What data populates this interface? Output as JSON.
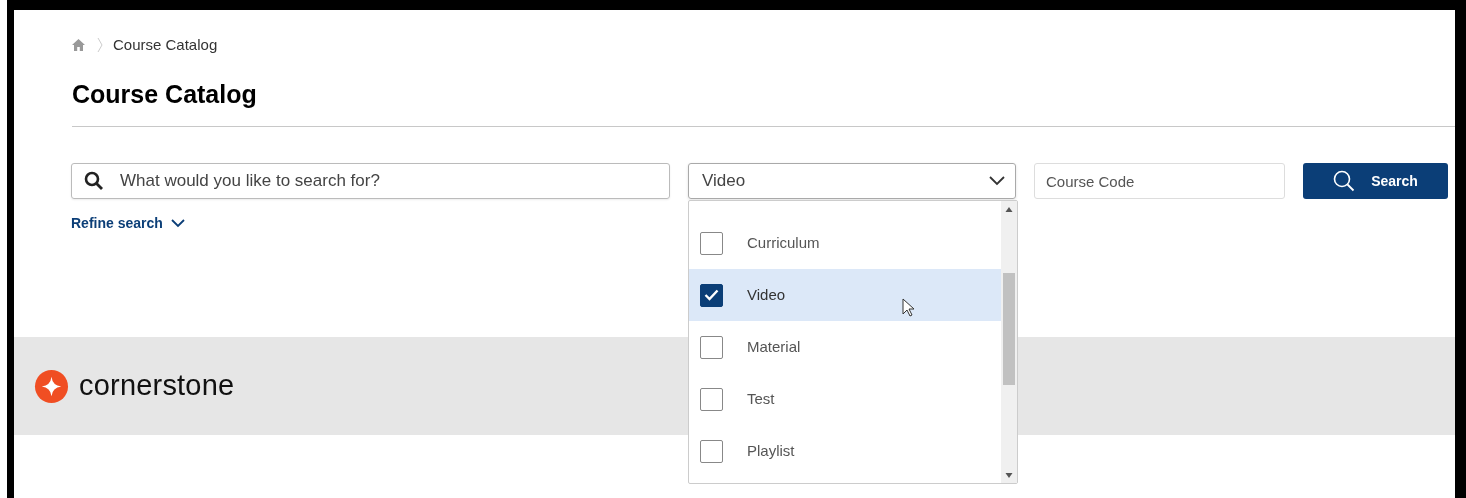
{
  "breadcrumb": {
    "items": [
      "Course Catalog"
    ]
  },
  "title": "Course Catalog",
  "search": {
    "placeholder": "What would you like to search for?"
  },
  "type_select": {
    "value": "Video",
    "expanded": true,
    "options": [
      {
        "label": "Curriculum",
        "checked": false,
        "selected": false
      },
      {
        "label": "Video",
        "checked": true,
        "selected": true
      },
      {
        "label": "Material",
        "checked": false,
        "selected": false
      },
      {
        "label": "Test",
        "checked": false,
        "selected": false
      },
      {
        "label": "Playlist",
        "checked": false,
        "selected": false
      }
    ]
  },
  "course_code": {
    "placeholder": "Course Code"
  },
  "search_button": {
    "label": "Search"
  },
  "refine_search": {
    "label": "Refine search",
    "expanded": false
  },
  "footer": {
    "logo_text": "cornerstone"
  }
}
